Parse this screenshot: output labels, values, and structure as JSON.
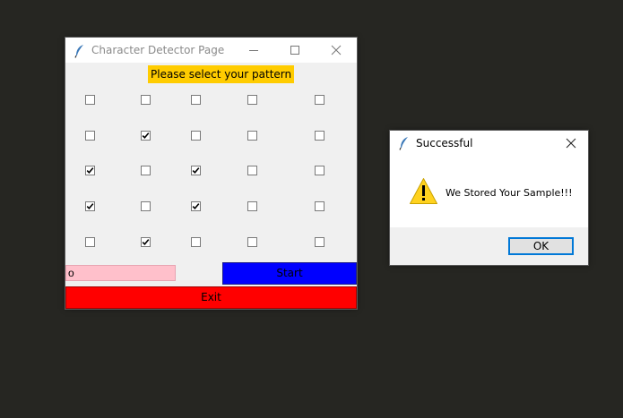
{
  "main_window": {
    "title": "Character Detector Page",
    "prompt": "Please select your pattern",
    "grid": [
      [
        false,
        false,
        false,
        false,
        false
      ],
      [
        false,
        true,
        false,
        false,
        false
      ],
      [
        true,
        false,
        true,
        false,
        false
      ],
      [
        true,
        false,
        true,
        false,
        false
      ],
      [
        false,
        true,
        false,
        false,
        false
      ]
    ],
    "name_value": "o",
    "start_label": "Start",
    "exit_label": "Exit",
    "colors": {
      "prompt_bg": "#ffcc00",
      "entry_bg": "#ffc0cb",
      "start_bg": "#0000ff",
      "exit_bg": "#ff0000"
    }
  },
  "dialog": {
    "title": "Successful",
    "icon": "warning-icon",
    "message": "We Stored Your Sample!!!",
    "ok_label": "OK"
  }
}
